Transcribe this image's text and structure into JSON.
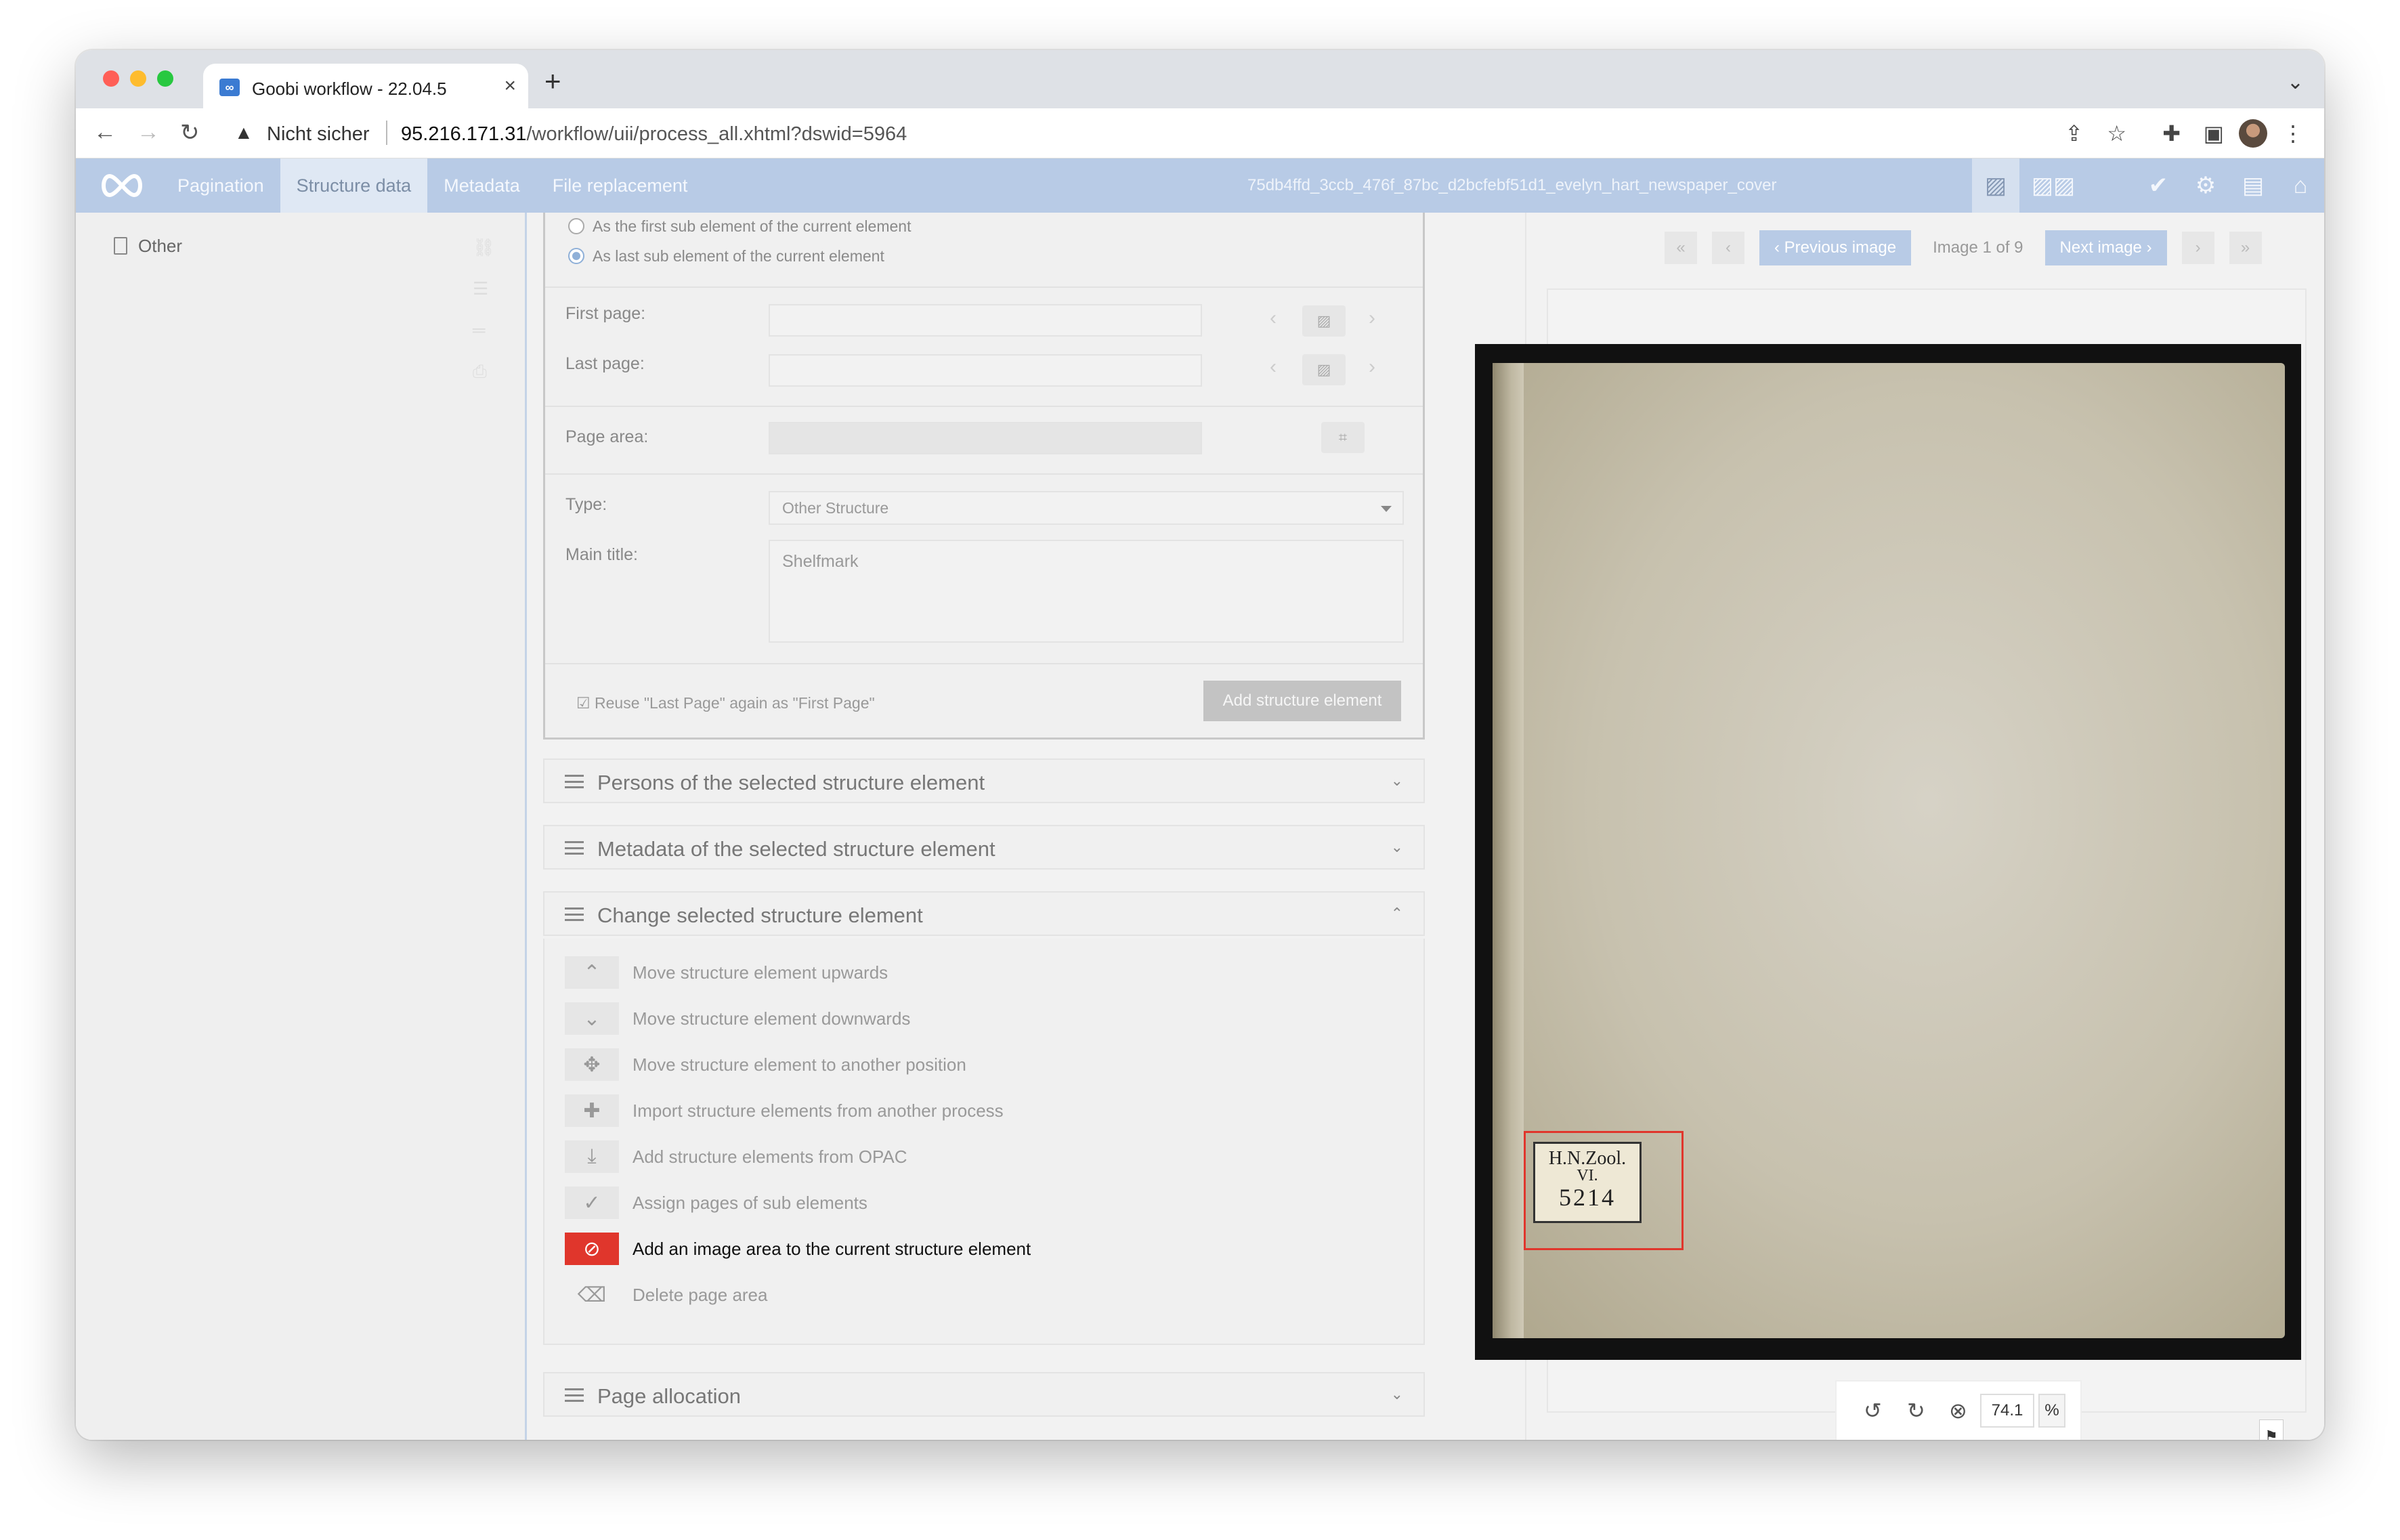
{
  "browser": {
    "tab_title": "Goobi workflow - 22.04.5",
    "security_label": "Nicht sicher",
    "url_host": "95.216.171.31",
    "url_path": "/workflow/uii/process_all.xhtml?dswid=5964"
  },
  "app": {
    "nav": [
      "Pagination",
      "Structure data",
      "Metadata",
      "File replacement"
    ],
    "active_nav": "Structure data",
    "process_id": "75db4ffd_3ccb_476f_87bc_d2bcfebf51d1_evelyn_hart_newspaper_cover"
  },
  "tree": {
    "node_label": "Other"
  },
  "form": {
    "radio_first": "As the first sub element of the current element",
    "radio_last": "As last sub element of the current element",
    "first_page_label": "First page:",
    "last_page_label": "Last page:",
    "page_area_label": "Page area:",
    "type_label": "Type:",
    "type_value": "Other Structure",
    "main_title_label": "Main title:",
    "main_title_placeholder": "Shelfmark",
    "reuse_label": "Reuse \"Last Page\" again as \"First Page\"",
    "add_button": "Add structure element"
  },
  "accordions": {
    "persons": "Persons of the selected structure element",
    "metadata": "Metadata of the selected structure element",
    "change": "Change selected structure element",
    "page_allocation": "Page allocation"
  },
  "actions": [
    "Move structure element upwards",
    "Move structure element downwards",
    "Move structure element to another position",
    "Import structure elements from another process",
    "Add structure elements from OPAC",
    "Assign pages of sub elements",
    "Add an image area to the current structure element",
    "Delete page area"
  ],
  "viewer": {
    "prev_label": "Previous image",
    "counter": "Image 1 of 9",
    "next_label": "Next image",
    "label_line1": "H.N.Zool.",
    "label_line2": "VI.",
    "label_line3": "5214",
    "zoom_value": "74.1",
    "zoom_unit": "%"
  },
  "colors": {
    "appbar": "#b8cbe6",
    "highlight_action": "#e0362c"
  }
}
